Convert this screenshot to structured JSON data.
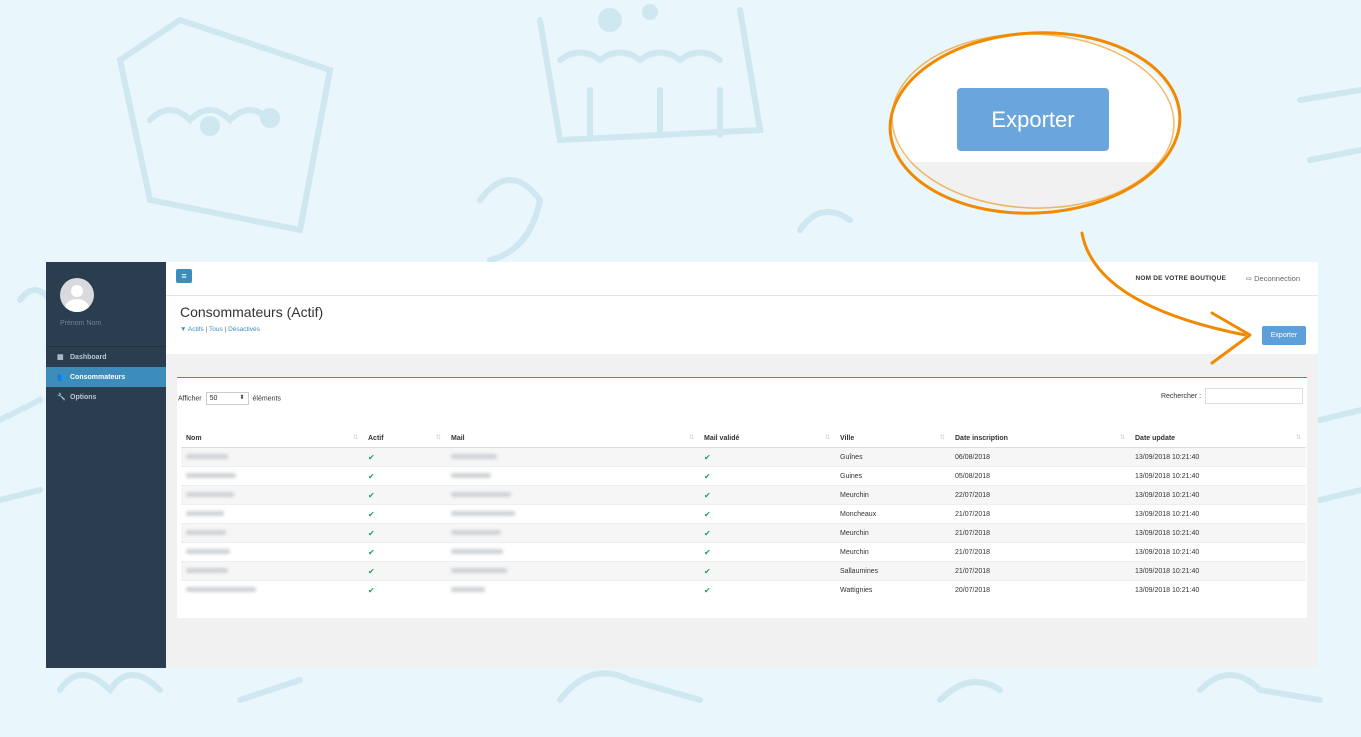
{
  "colors": {
    "accent": "#3c8dbc",
    "sidebar": "#2b3e4f",
    "annotation": "#f08a00",
    "check": "#16a35a"
  },
  "sidebar": {
    "user_name": "Prénom Nom",
    "items": [
      {
        "label": "Dashboard",
        "icon": "grid-icon",
        "glyph": "▦"
      },
      {
        "label": "Consommateurs",
        "icon": "users-icon",
        "glyph": "👥"
      },
      {
        "label": "Options",
        "icon": "wrench-icon",
        "glyph": "🔧"
      }
    ]
  },
  "topbar": {
    "menu_glyph": "≡",
    "shop_name": "NOM DE VOTRE BOUTIQUE",
    "logout_glyph": "⇨",
    "logout_label": "Deconnection"
  },
  "header": {
    "title": "Consommateurs (Actif)",
    "filter_glyph": "▼",
    "filters": [
      "Actifs",
      "Tous",
      "Désactivés"
    ],
    "separator": "|",
    "export_label": "Exporter"
  },
  "zoom": {
    "export_label": "Exporter"
  },
  "table_controls": {
    "length_prefix": "Afficher",
    "length_value": "50",
    "length_suffix": "éléments",
    "search_label": "Rechercher :"
  },
  "table": {
    "headers": [
      "Nom",
      "Actif",
      "Mail",
      "Mail validé",
      "Ville",
      "Date inscription",
      "Date update"
    ],
    "sort_glyph": "⇅",
    "check_glyph": "✔",
    "rows": [
      {
        "ville": "Guînes",
        "inscription": "06/08/2018",
        "update": "13/09/2018 10:21:40"
      },
      {
        "ville": "Guines",
        "inscription": "05/08/2018",
        "update": "13/09/2018 10:21:40"
      },
      {
        "ville": "Meurchin",
        "inscription": "22/07/2018",
        "update": "13/09/2018 10:21:40"
      },
      {
        "ville": "Moncheaux",
        "inscription": "21/07/2018",
        "update": "13/09/2018 10:21:40"
      },
      {
        "ville": "Meurchin",
        "inscription": "21/07/2018",
        "update": "13/09/2018 10:21:40"
      },
      {
        "ville": "Meurchin",
        "inscription": "21/07/2018",
        "update": "13/09/2018 10:21:40"
      },
      {
        "ville": "Sallaumines",
        "inscription": "21/07/2018",
        "update": "13/09/2018 10:21:40"
      },
      {
        "ville": "Wattignies",
        "inscription": "20/07/2018",
        "update": "13/09/2018 10:21:40"
      }
    ]
  }
}
